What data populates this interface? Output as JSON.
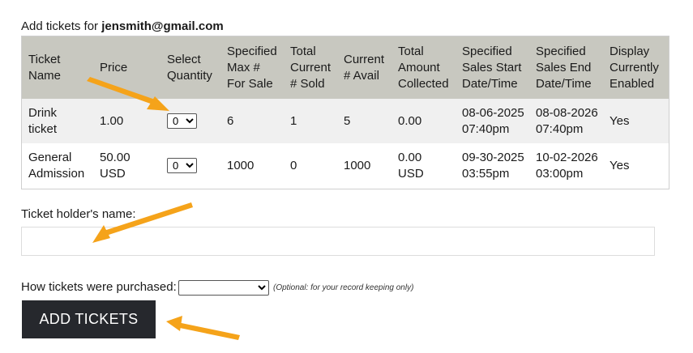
{
  "header": {
    "prefix": "Add tickets for ",
    "email": "jensmith@gmail.com"
  },
  "table": {
    "headers": [
      "Ticket Name",
      "Price",
      "Select Quantity",
      "Specified Max # For Sale",
      "Total Current # Sold",
      "Current # Avail",
      "Total Amount Collected",
      "Specified Sales Start Date/Time",
      "Specified Sales End Date/Time",
      "Display Currently Enabled"
    ],
    "rows": [
      {
        "name": "Drink ticket",
        "price": "1.00",
        "qty": "0",
        "max": "6",
        "sold": "1",
        "avail": "5",
        "collected": "0.00",
        "start": "08-06-2025 07:40pm",
        "end": "08-08-2026 07:40pm",
        "enabled": "Yes"
      },
      {
        "name": "General Admission",
        "price": "50.00 USD",
        "qty": "0",
        "max": "1000",
        "sold": "0",
        "avail": "1000",
        "collected": "0.00 USD",
        "start": "09-30-2025 03:55pm",
        "end": "10-02-2026 03:00pm",
        "enabled": "Yes"
      }
    ]
  },
  "holder": {
    "label": "Ticket holder's name:",
    "value": ""
  },
  "purchase": {
    "label": "How tickets were purchased:",
    "selected": "",
    "note": "(Optional: for your record keeping only)"
  },
  "button": {
    "label": "ADD TICKETS"
  },
  "colors": {
    "arrow": "#f5a31a",
    "header_bg": "#c8c8c0",
    "button_bg": "#26282d"
  }
}
